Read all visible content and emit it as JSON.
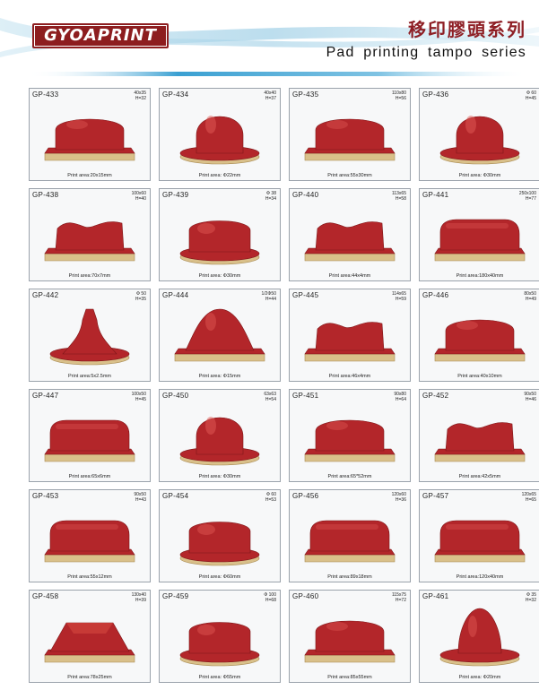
{
  "brand": {
    "logo_text": "GYOAPRINT"
  },
  "header": {
    "title_cn": "移印膠頭系列",
    "title_en": "Pad   printing tampo series"
  },
  "colors": {
    "brand_red": "#8e1f25",
    "pad_red": "#b3262a",
    "base_tan": "#d9c08a"
  },
  "products": [
    {
      "code": "GP-433",
      "size": "40x35",
      "height": "H=32",
      "area": "Print area:20x15mm",
      "shape": "rect-dome"
    },
    {
      "code": "GP-434",
      "size": "40x40",
      "height": "H=37",
      "area": "Print area: Φ22mm",
      "shape": "round-dome"
    },
    {
      "code": "GP-435",
      "size": "110x80",
      "height": "H=56",
      "area": "Print area:55x30mm",
      "shape": "rect-dome"
    },
    {
      "code": "GP-436",
      "size": "Φ 60",
      "height": "H=45",
      "area": "Print area: Φ30mm",
      "shape": "round-dome"
    },
    {
      "code": "GP-438",
      "size": "100x60",
      "height": "H=40",
      "area": "Print area:70x7mm",
      "shape": "wave"
    },
    {
      "code": "GP-439",
      "size": "Φ 38",
      "height": "H=34",
      "area": "Print area: Φ30mm",
      "shape": "cylinder"
    },
    {
      "code": "GP-440",
      "size": "113x65",
      "height": "H=58",
      "area": "Print area:44x4mm",
      "shape": "wave"
    },
    {
      "code": "GP-441",
      "size": "250x100",
      "height": "H=77",
      "area": "Print area:180x40mm",
      "shape": "long"
    },
    {
      "code": "GP-442",
      "size": "Φ 50",
      "height": "H=35",
      "area": "Print area:5x2.5mm",
      "shape": "cone"
    },
    {
      "code": "GP-444",
      "size": "1/2Φ50",
      "height": "H=44",
      "area": "Print area: Φ15mm",
      "shape": "half-dome"
    },
    {
      "code": "GP-445",
      "size": "114x65",
      "height": "H=59",
      "area": "Print area:46x4mm",
      "shape": "wave"
    },
    {
      "code": "GP-446",
      "size": "80x50",
      "height": "H=49",
      "area": "Print area:40x10mm",
      "shape": "rect-dome"
    },
    {
      "code": "GP-447",
      "size": "100x50",
      "height": "H=45",
      "area": "Print area:65x6mm",
      "shape": "long"
    },
    {
      "code": "GP-450",
      "size": "63x63",
      "height": "H=54",
      "area": "Print area: Φ30mm",
      "shape": "round-dome"
    },
    {
      "code": "GP-451",
      "size": "90x80",
      "height": "H=64",
      "area": "Print area:65*52mm",
      "shape": "rect-dome"
    },
    {
      "code": "GP-452",
      "size": "90x50",
      "height": "H=46",
      "area": "Print area:42x5mm",
      "shape": "wave"
    },
    {
      "code": "GP-453",
      "size": "90x50",
      "height": "H=43",
      "area": "Print area:55x12mm",
      "shape": "long"
    },
    {
      "code": "GP-454",
      "size": "Φ 60",
      "height": "H=53",
      "area": "Print area: Φ60mm",
      "shape": "cylinder"
    },
    {
      "code": "GP-456",
      "size": "120x60",
      "height": "H=36",
      "area": "Print area:89x18mm",
      "shape": "long"
    },
    {
      "code": "GP-457",
      "size": "120x65",
      "height": "H=65",
      "area": "Print area:120x40mm",
      "shape": "long"
    },
    {
      "code": "GP-458",
      "size": "130x40",
      "height": "H=39",
      "area": "Print area:78x25mm",
      "shape": "roof"
    },
    {
      "code": "GP-459",
      "size": "Φ 100",
      "height": "H=68",
      "area": "Print area: Φ55mm",
      "shape": "cylinder"
    },
    {
      "code": "GP-460",
      "size": "115x75",
      "height": "H=72",
      "area": "Print area:85x55mm",
      "shape": "rect-dome"
    },
    {
      "code": "GP-461",
      "size": "Φ 35",
      "height": "H=32",
      "area": "Print area: Φ20mm",
      "shape": "bullet"
    }
  ]
}
